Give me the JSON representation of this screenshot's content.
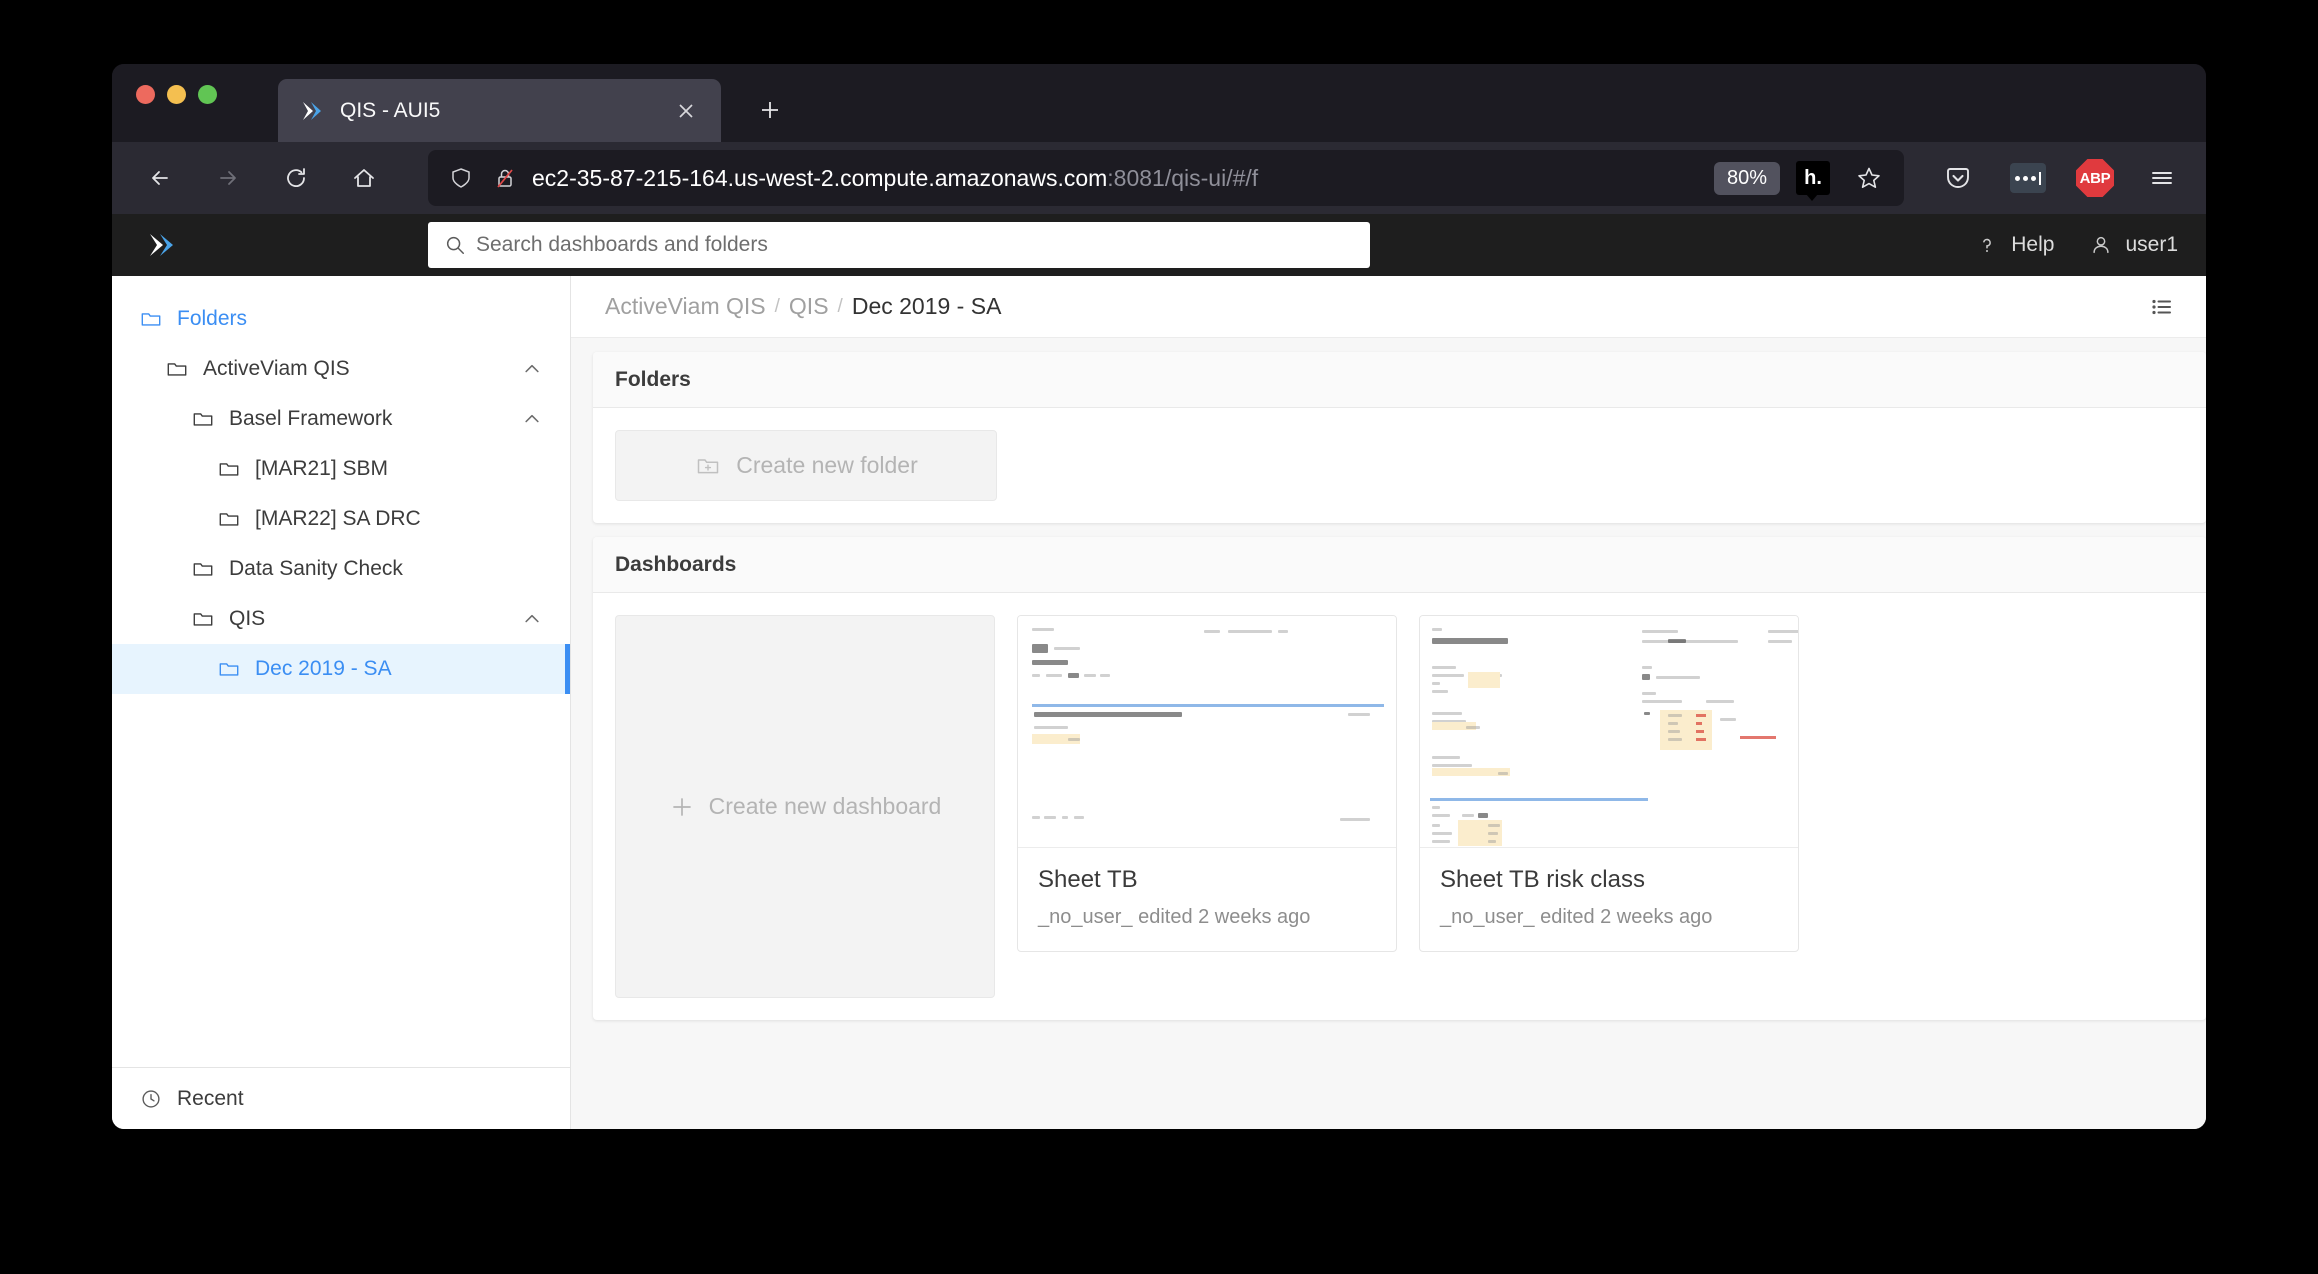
{
  "browser": {
    "tab": {
      "title": "QIS - AUI5",
      "favicon": "activeviam-logo-icon",
      "close_label": "×"
    },
    "new_tab_label": "+",
    "nav": {
      "back": "back-arrow-icon",
      "forward": "forward-arrow-icon",
      "reload": "reload-icon",
      "home": "home-icon"
    },
    "url": {
      "shield_icon": "shield-icon",
      "lock_icon": "lock-crossed-icon",
      "host": "ec2-35-87-215-164.us-west-2.compute.amazonaws.com",
      "path": ":8081/qis-ui/#/f",
      "zoom_level": "80%",
      "extension_badge": "h.",
      "bookmark_icon": "star-icon"
    },
    "toolbar": {
      "pocket": "pocket-icon",
      "dots_extension": "dots-extension-icon",
      "adblock": "ABP",
      "menu": "hamburger-menu-icon"
    }
  },
  "app_header": {
    "logo": "activeviam-logo-icon",
    "search": {
      "placeholder": "Search dashboards and folders",
      "value": ""
    },
    "help": {
      "icon": "question-mark-icon",
      "label": "Help"
    },
    "user": {
      "icon": "person-icon",
      "label": "user1"
    }
  },
  "sidebar": {
    "root": {
      "label": "Folders",
      "icon": "folder-icon"
    },
    "items": [
      {
        "label": "ActiveViam QIS",
        "depth": 1,
        "expanded": true,
        "selected": false
      },
      {
        "label": "Basel Framework",
        "depth": 2,
        "expanded": true,
        "selected": false
      },
      {
        "label": "[MAR21] SBM",
        "depth": 3,
        "expanded": false,
        "selected": false
      },
      {
        "label": "[MAR22] SA DRC",
        "depth": 3,
        "expanded": false,
        "selected": false
      },
      {
        "label": "Data Sanity Check",
        "depth": 2,
        "expanded": false,
        "selected": false
      },
      {
        "label": "QIS",
        "depth": 2,
        "expanded": true,
        "selected": false
      },
      {
        "label": "Dec 2019 - SA",
        "depth": 3,
        "expanded": false,
        "selected": true
      }
    ],
    "footer": {
      "label": "Recent",
      "icon": "clock-icon"
    }
  },
  "main": {
    "breadcrumb": [
      {
        "label": "ActiveViam QIS",
        "current": false
      },
      {
        "label": "QIS",
        "current": false
      },
      {
        "label": "Dec 2019 - SA",
        "current": true
      }
    ],
    "breadcrumb_separator": "/",
    "view_toggle_icon": "list-view-icon",
    "folders_panel": {
      "title": "Folders",
      "create_button": {
        "label": "Create new folder",
        "icon": "folder-plus-icon"
      }
    },
    "dashboards_panel": {
      "title": "Dashboards",
      "create_tile": {
        "label": "Create new dashboard",
        "icon": "plus-icon"
      },
      "cards": [
        {
          "title": "Sheet TB",
          "subtitle": "_no_user_ edited 2 weeks ago"
        },
        {
          "title": "Sheet TB risk class",
          "subtitle": "_no_user_ edited 2 weeks ago"
        }
      ]
    }
  },
  "colors": {
    "accent_blue": "#3b8ef3",
    "selected_bg": "#e7f4fe",
    "browser_chrome": "#2b2a33",
    "tab_active": "#42414d",
    "app_header": "#1e1e1e",
    "abp_red": "#e03a3e"
  }
}
